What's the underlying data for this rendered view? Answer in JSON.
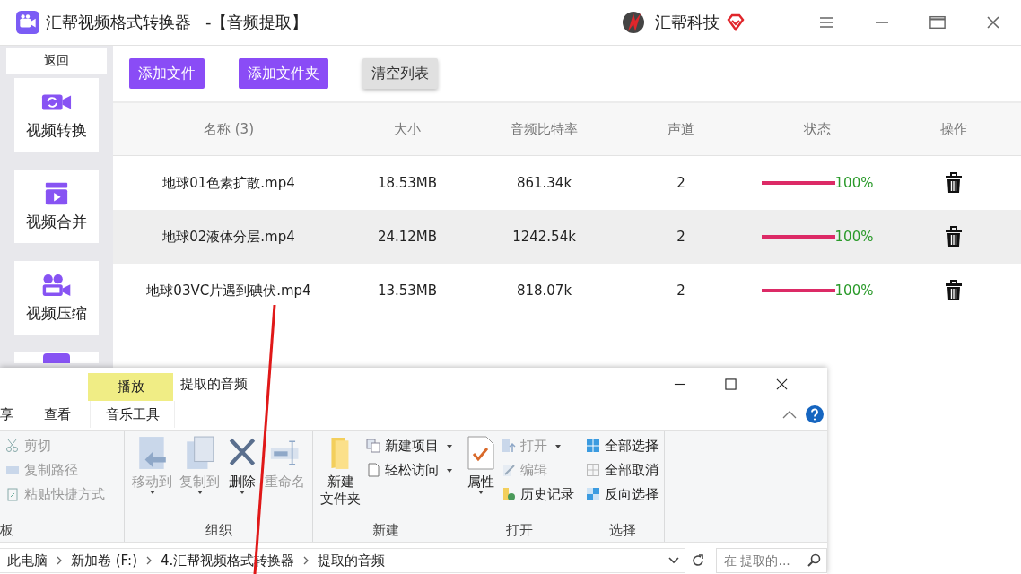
{
  "app": {
    "title": "汇帮视频格式转换器",
    "subtitle": "-【音频提取】",
    "brand": "汇帮科技"
  },
  "sidebar": {
    "back": "返回",
    "items": [
      {
        "kind": "convert",
        "label": "视频转换"
      },
      {
        "kind": "merge",
        "label": "视频合并"
      },
      {
        "kind": "compress",
        "label": "视频压缩"
      },
      {
        "kind": "gif"
      }
    ]
  },
  "toolbar": [
    {
      "label": "添加文件",
      "kind": "primary"
    },
    {
      "label": "添加文件夹",
      "kind": "primary"
    },
    {
      "label": "清空列表",
      "kind": "secondary"
    }
  ],
  "table": {
    "columns": [
      "名称 (3)",
      "大小",
      "音频比特率",
      "声道",
      "状态",
      "操作"
    ],
    "rows": [
      {
        "name": "地球01色素扩散.mp4",
        "size": "18.53MB",
        "bitrate": "861.34k",
        "channels": "2",
        "level": 1,
        "progress": "100%",
        "selected": false
      },
      {
        "name": "地球02液体分层.mp4",
        "size": "24.12MB",
        "bitrate": "1242.54k",
        "channels": "2",
        "level": 1,
        "progress": "100%",
        "selected": true
      },
      {
        "name": "地球03VC片遇到碘伏.mp4",
        "size": "13.53MB",
        "bitrate": "818.07k",
        "channels": "2",
        "level": 1,
        "progress": "100%",
        "selected": false
      }
    ]
  },
  "explorer": {
    "context_tab": "播放",
    "title": "提取的音频",
    "tabs": [
      {
        "label": "享",
        "selected": false
      },
      {
        "label": "查看",
        "selected": false
      },
      {
        "label": "音乐工具",
        "selected": true
      }
    ],
    "groups": [
      {
        "label": "板",
        "commands": [
          {
            "kind": "cut",
            "label": "剪切",
            "disabled": true
          },
          {
            "kind": "copypath",
            "label": "复制路径",
            "disabled": true
          },
          {
            "kind": "paste",
            "label": "粘贴快捷方式",
            "disabled": true
          }
        ]
      },
      {
        "label": "组织",
        "commands": [
          {
            "kind": "move",
            "label": "移动到",
            "disabled": true
          },
          {
            "kind": "copy",
            "label": "复制到",
            "disabled": true
          },
          {
            "kind": "delete",
            "label": "删除",
            "disabled": false
          },
          {
            "kind": "rename",
            "label": "重命名",
            "disabled": true
          }
        ]
      },
      {
        "label": "新建",
        "commands": [
          {
            "kind": "folder",
            "label": [
              "新建",
              "文件夹"
            ],
            "disabled": false
          },
          {
            "kind": "newitem",
            "label": "新建项目",
            "disabled": false
          },
          {
            "kind": "access",
            "label": "轻松访问",
            "disabled": false
          }
        ]
      },
      {
        "label": "打开",
        "commands": [
          {
            "kind": "properties",
            "label": "属性",
            "disabled": false
          },
          {
            "kind": "open",
            "label": "打开",
            "disabled": true
          },
          {
            "kind": "edit",
            "label": "编辑",
            "disabled": true
          },
          {
            "kind": "history",
            "label": "历史记录",
            "disabled": false
          }
        ]
      },
      {
        "label": "选择",
        "commands": [
          {
            "kind": "selectall",
            "label": "全部选择",
            "disabled": false
          },
          {
            "kind": "selectnone",
            "label": "全部取消",
            "disabled": false
          },
          {
            "kind": "invert",
            "label": "反向选择",
            "disabled": false
          }
        ]
      }
    ],
    "path": [
      "此电脑",
      "新加卷 (F:)",
      "4.汇帮视频格式转换器",
      "提取的音频"
    ],
    "search": {
      "placeholder": "在 提取的..."
    }
  }
}
